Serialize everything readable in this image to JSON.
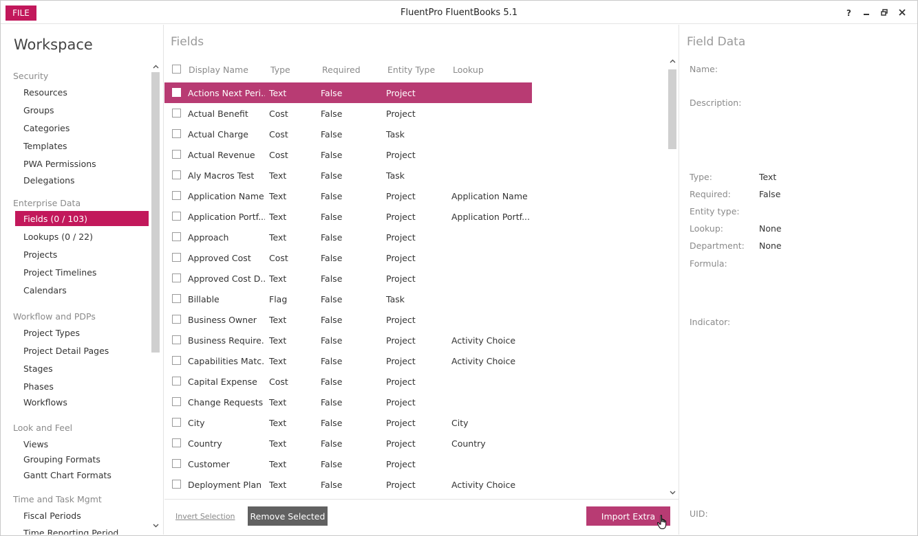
{
  "titlebar": {
    "file_label": "FILE",
    "app_title": "FluentPro FluentBooks 5.1"
  },
  "workspace": {
    "title": "Workspace",
    "groups": [
      {
        "label": "Security"
      },
      {
        "label": "Enterprise Data"
      },
      {
        "label": "Workflow and PDPs"
      },
      {
        "label": "Look and Feel"
      },
      {
        "label": "Time and Task Mgmt"
      }
    ],
    "items": [
      {
        "label": "Resources"
      },
      {
        "label": "Groups"
      },
      {
        "label": "Categories"
      },
      {
        "label": "Templates"
      },
      {
        "label": "PWA Permissions"
      },
      {
        "label": "Delegations"
      },
      {
        "label": "Fields (0 / 103)"
      },
      {
        "label": "Lookups (0 / 22)"
      },
      {
        "label": "Projects"
      },
      {
        "label": "Project Timelines"
      },
      {
        "label": "Calendars"
      },
      {
        "label": "Project Types"
      },
      {
        "label": "Project Detail Pages"
      },
      {
        "label": "Stages"
      },
      {
        "label": "Phases"
      },
      {
        "label": "Workflows"
      },
      {
        "label": "Views"
      },
      {
        "label": "Grouping Formats"
      },
      {
        "label": "Gantt Chart Formats"
      },
      {
        "label": "Fiscal Periods"
      },
      {
        "label": "Time Reporting Period"
      }
    ]
  },
  "fields": {
    "title": "Fields",
    "columns": {
      "display_name": "Display Name",
      "type": "Type",
      "required": "Required",
      "entity_type": "Entity Type",
      "lookup": "Lookup"
    },
    "rows": [
      {
        "name": "Actions Next Peri...",
        "type": "Text",
        "required": "False",
        "entity": "Project",
        "lookup": ""
      },
      {
        "name": "Actual Benefit",
        "type": "Cost",
        "required": "False",
        "entity": "Project",
        "lookup": ""
      },
      {
        "name": "Actual Charge",
        "type": "Cost",
        "required": "False",
        "entity": "Task",
        "lookup": ""
      },
      {
        "name": "Actual Revenue",
        "type": "Cost",
        "required": "False",
        "entity": "Project",
        "lookup": ""
      },
      {
        "name": "Aly Macros Test",
        "type": "Text",
        "required": "False",
        "entity": "Task",
        "lookup": ""
      },
      {
        "name": "Application Name",
        "type": "Text",
        "required": "False",
        "entity": "Project",
        "lookup": "Application Name"
      },
      {
        "name": "Application Portf...",
        "type": "Text",
        "required": "False",
        "entity": "Project",
        "lookup": "Application Portf..."
      },
      {
        "name": "Approach",
        "type": "Text",
        "required": "False",
        "entity": "Project",
        "lookup": ""
      },
      {
        "name": "Approved Cost",
        "type": "Cost",
        "required": "False",
        "entity": "Project",
        "lookup": ""
      },
      {
        "name": "Approved Cost D...",
        "type": "Text",
        "required": "False",
        "entity": "Project",
        "lookup": ""
      },
      {
        "name": "Billable",
        "type": "Flag",
        "required": "False",
        "entity": "Task",
        "lookup": ""
      },
      {
        "name": "Business Owner",
        "type": "Text",
        "required": "False",
        "entity": "Project",
        "lookup": ""
      },
      {
        "name": "Business Require...",
        "type": "Text",
        "required": "False",
        "entity": "Project",
        "lookup": "Activity Choice"
      },
      {
        "name": "Capabilities Matc...",
        "type": "Text",
        "required": "False",
        "entity": "Project",
        "lookup": "Activity Choice"
      },
      {
        "name": "Capital Expense",
        "type": "Cost",
        "required": "False",
        "entity": "Project",
        "lookup": ""
      },
      {
        "name": "Change Requests",
        "type": "Text",
        "required": "False",
        "entity": "Project",
        "lookup": ""
      },
      {
        "name": "City",
        "type": "Text",
        "required": "False",
        "entity": "Project",
        "lookup": "City"
      },
      {
        "name": "Country",
        "type": "Text",
        "required": "False",
        "entity": "Project",
        "lookup": "Country"
      },
      {
        "name": "Customer",
        "type": "Text",
        "required": "False",
        "entity": "Project",
        "lookup": ""
      },
      {
        "name": "Deployment Plan",
        "type": "Text",
        "required": "False",
        "entity": "Project",
        "lookup": "Activity Choice"
      }
    ],
    "footer": {
      "invert_label": "Invert Selection",
      "remove_label": "Remove Selected",
      "import_label": "Import Extra"
    }
  },
  "field_data": {
    "title": "Field Data",
    "name_label": "Name:",
    "description_label": "Description:",
    "type_label": "Type:",
    "type_value": "Text",
    "required_label": "Required:",
    "required_value": "False",
    "entity_label": "Entity type:",
    "entity_value": "",
    "lookup_label": "Lookup:",
    "lookup_value": "None",
    "department_label": "Department:",
    "department_value": "None",
    "formula_label": "Formula:",
    "indicator_label": "Indicator:",
    "uid_label": "UID:"
  },
  "colors": {
    "accent": "#c2185b",
    "selected_row": "#b83b73",
    "button_dark": "#616161"
  },
  "icons": [
    "help-icon",
    "minimize-icon",
    "restore-icon",
    "close-icon",
    "scroll-up-icon",
    "scroll-down-icon",
    "hand-cursor-icon"
  ]
}
